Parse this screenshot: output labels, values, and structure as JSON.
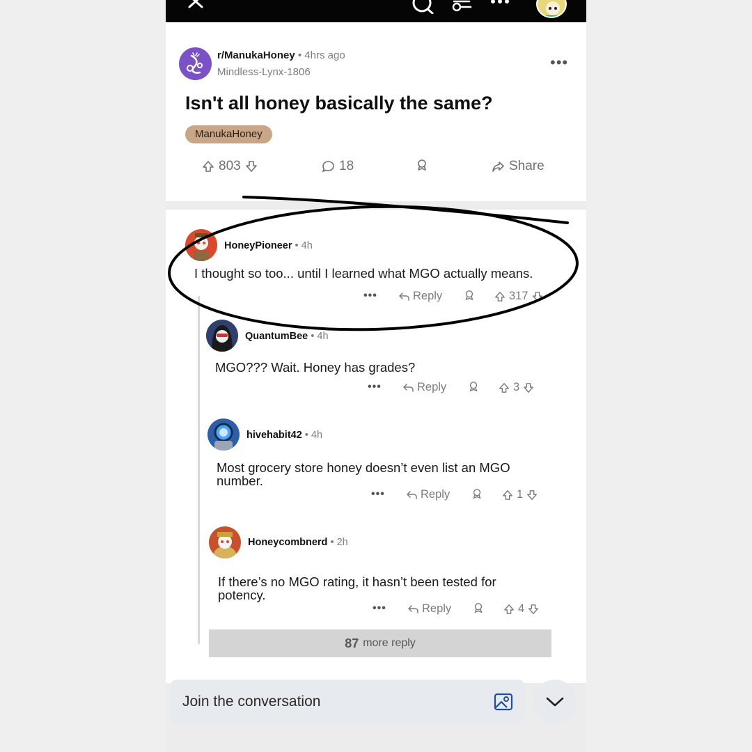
{
  "post": {
    "subreddit": "r/ManukaHoney",
    "time": "4hrs ago",
    "author": "Mindless-Lynx-1806",
    "title": "Isn't all honey basically the same?",
    "flair": "ManukaHoney",
    "upvotes": "803",
    "comments": "18",
    "share_label": "Share",
    "more_icon": "more-horizontal-icon"
  },
  "comments": [
    {
      "user": "HoneyPioneer",
      "time": "4h",
      "text": "I thought so too... until I learned what MGO actually means.",
      "reply_label": "Reply",
      "votes": "317"
    },
    {
      "user": "QuantumBee",
      "time": "4h",
      "text": "MGO??? Wait. Honey has grades?",
      "reply_label": "Reply",
      "votes": "3"
    },
    {
      "user": "hivehabit42",
      "time": "4h",
      "text": "Most grocery store honey doesn’t even list an MGO number.",
      "reply_label": "Reply",
      "votes": "1"
    },
    {
      "user": "Honeycombnerd",
      "time": "2h",
      "text": "If there’s no MGO rating, it hasn’t been tested for potency.",
      "reply_label": "Reply",
      "votes": "4"
    }
  ],
  "more_replies": {
    "count": "87",
    "label": "more reply"
  },
  "composer": {
    "placeholder": "Join the conversation"
  },
  "colors": {
    "subreddit_avatar": "#7b51c8",
    "flair_bg": "#c8a687",
    "topbar": "#050505",
    "annotation": "#000000"
  }
}
